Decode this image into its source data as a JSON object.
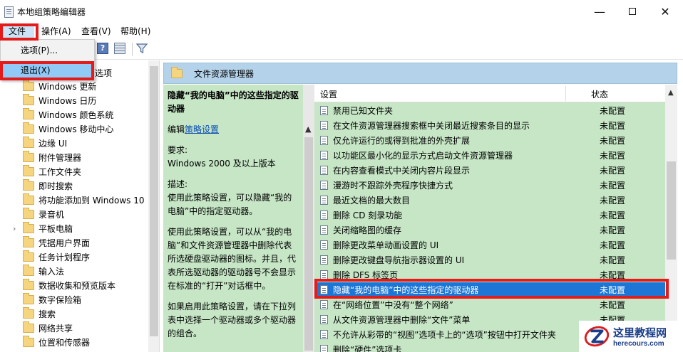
{
  "window": {
    "title": "本地组策略编辑器",
    "minimize": "—",
    "close": "✕"
  },
  "menubar": {
    "file": "文件(F)",
    "action": "操作(A)",
    "view": "查看(V)",
    "help": "帮助(H)"
  },
  "toolbar": {
    "help_icon": "?"
  },
  "file_menu": {
    "items": [
      "选项(P)...",
      "退出(X)"
    ]
  },
  "tree": {
    "partial_item": "选项",
    "items": [
      {
        "label": "Windows 更新",
        "expandable": false
      },
      {
        "label": "Windows 日历",
        "expandable": false
      },
      {
        "label": "Windows 颜色系统",
        "expandable": false
      },
      {
        "label": "Windows 移动中心",
        "expandable": false
      },
      {
        "label": "边缘 UI",
        "expandable": false
      },
      {
        "label": "附件管理器",
        "expandable": false
      },
      {
        "label": "工作文件夹",
        "expandable": false
      },
      {
        "label": "即时搜索",
        "expandable": false
      },
      {
        "label": "将功能添加到 Windows 10",
        "expandable": false
      },
      {
        "label": "录音机",
        "expandable": false
      },
      {
        "label": "平板电脑",
        "expandable": true
      },
      {
        "label": "凭据用户界面",
        "expandable": false
      },
      {
        "label": "任务计划程序",
        "expandable": false
      },
      {
        "label": "输入法",
        "expandable": false
      },
      {
        "label": "数据收集和预览版本",
        "expandable": false
      },
      {
        "label": "数字保险箱",
        "expandable": false
      },
      {
        "label": "搜索",
        "expandable": false
      },
      {
        "label": "网络共享",
        "expandable": false
      },
      {
        "label": "位置和传感器",
        "expandable": false
      }
    ]
  },
  "content": {
    "header_title": "文件资源管理器",
    "description": {
      "title": "隐藏“我的电脑”中的这些指定的驱动器",
      "edit_prefix": "编辑",
      "edit_link": "策略设置",
      "requirement_label": "要求:",
      "requirement_value": "Windows 2000 及以上版本",
      "desc_label": "描述:",
      "desc_1": "使用此策略设置，可以隐藏“我的电脑”中的指定驱动器。",
      "desc_2": "使用此策略设置，可以从“我的电脑”和文件资源管理器中删除代表所选硬盘驱动器的图标。并且，代表所选驱动器的驱动器号不会显示在标准的“打开”对话框中。",
      "desc_3": "如果启用此策略设置，请在下拉列表中选择一个驱动器或多个驱动器的组合。"
    },
    "columns": {
      "setting": "设置",
      "state": "状态"
    },
    "rows": [
      {
        "name": "禁用已知文件夹",
        "state": "未配置"
      },
      {
        "name": "在文件资源管理器搜索框中关闭最近搜索条目的显示",
        "state": "未配置"
      },
      {
        "name": "仅允许运行的或得到批准的外壳扩展",
        "state": "未配置"
      },
      {
        "name": "以功能区最小化的显示方式启动文件资源管理器",
        "state": "未配置"
      },
      {
        "name": "在内容查看模式中关闭内容片段显示",
        "state": "未配置"
      },
      {
        "name": "漫游时不跟踪外壳程序快捷方式",
        "state": "未配置"
      },
      {
        "name": "最近文档的最大数目",
        "state": "未配置"
      },
      {
        "name": "删除 CD 刻录功能",
        "state": "未配置"
      },
      {
        "name": "关闭缩略图的缓存",
        "state": "未配置"
      },
      {
        "name": "删除更改菜单动画设置的 UI",
        "state": "未配置"
      },
      {
        "name": "删除更改键盘导航指示器设置的 UI",
        "state": "未配置"
      },
      {
        "name": "删除 DFS 标签页",
        "state": "未配置"
      },
      {
        "name": "隐藏“我的电脑”中的这些指定的驱动器",
        "state": "未配置",
        "selected": true
      },
      {
        "name": "在“网络位置”中没有“整个网络”",
        "state": "未配置"
      },
      {
        "name": "从文件资源管理器中删除“文件”菜单",
        "state": "未配置"
      },
      {
        "name": "不允许从彩带的“视图”选项卡上的“选项”按钮中打开文件夹",
        "state": "未配置"
      },
      {
        "name": "删除“硬件”选项卡",
        "state": ""
      }
    ]
  },
  "watermark": {
    "name": "这里教程网",
    "url": "herecours.com"
  },
  "colors": {
    "highlight": "#e31b1b",
    "selected_row": "#1d76d6",
    "list_background": "#c6e6c6",
    "header_background": "#b4d3ea"
  }
}
